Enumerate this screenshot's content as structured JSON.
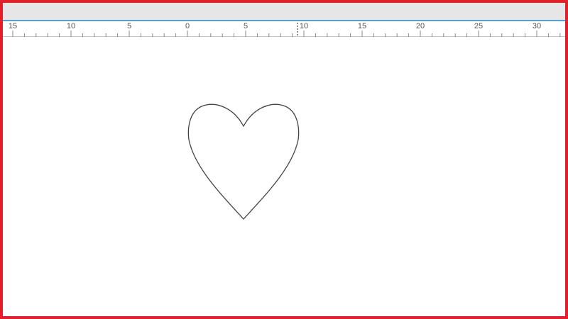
{
  "ruler": {
    "labels": [
      "15",
      "10",
      "5",
      "0",
      "5",
      "10",
      "15",
      "20",
      "25",
      "30"
    ]
  },
  "canvas": {
    "shape_icon": "heart-outline"
  },
  "colors": {
    "frame": "#e0202a",
    "ruler_accent": "#4da3d6",
    "shape_stroke": "#444444"
  }
}
